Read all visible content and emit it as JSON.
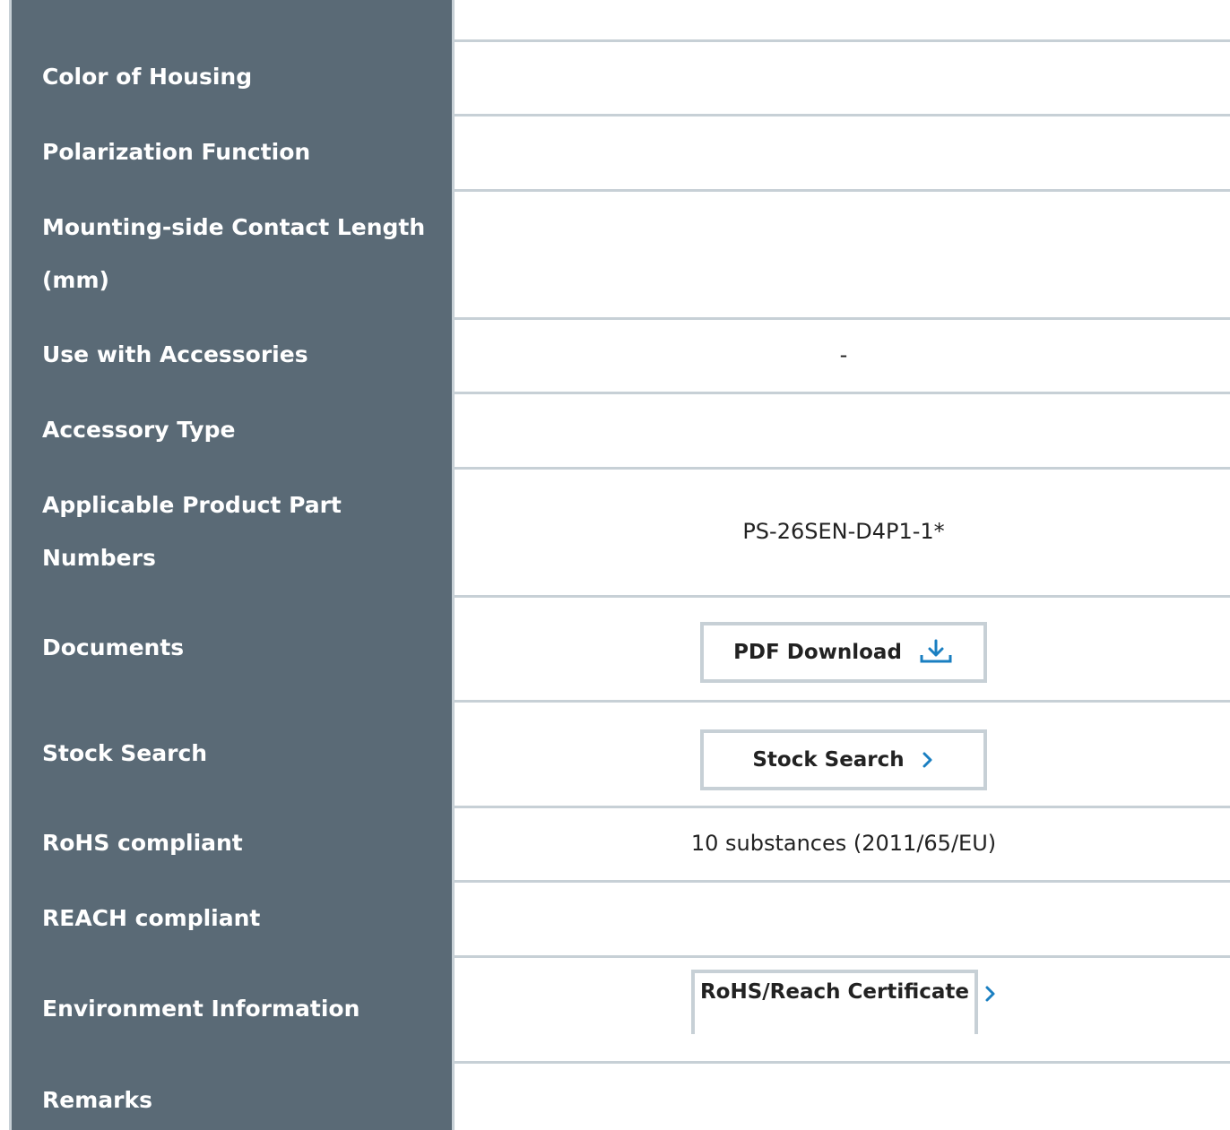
{
  "rows": [
    {
      "label": "",
      "value": ""
    },
    {
      "label": "Color of Housing",
      "value": ""
    },
    {
      "label": "Polarization Function",
      "value": ""
    },
    {
      "label": "Mounting-side Contact Length (mm)",
      "value": ""
    },
    {
      "label": "Use with Accessories",
      "value": "-"
    },
    {
      "label": "Accessory Type",
      "value": ""
    },
    {
      "label": "Applicable Product Part Numbers",
      "value": "PS-26SEN-D4P1-1*"
    },
    {
      "label": "Documents",
      "button": "PDF Download"
    },
    {
      "label": "Stock Search",
      "button": "Stock Search"
    },
    {
      "label": "RoHS compliant",
      "value": "10 substances (2011/65/EU)"
    },
    {
      "label": "REACH compliant",
      "value": ""
    },
    {
      "label": "Environment Information",
      "button": "RoHS/Reach Certificate"
    },
    {
      "label": "Remarks",
      "value": ""
    }
  ],
  "colors": {
    "header_bg": "#5a6a76",
    "header_text": "#ffffff",
    "border": "#c7d0d6",
    "accent": "#1a7fc1"
  },
  "icons": {
    "download": "download-icon",
    "chevron": "chevron-right-icon"
  }
}
